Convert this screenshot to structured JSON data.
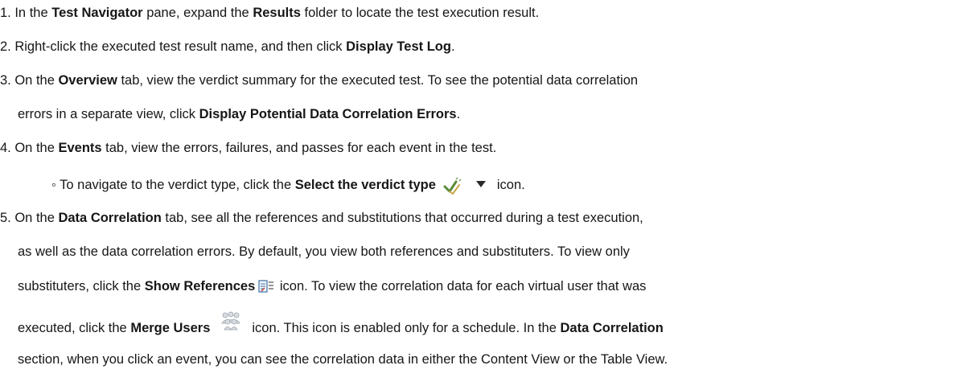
{
  "steps": [
    {
      "number": "1.",
      "t1": " In the ",
      "b1": "Test Navigator",
      "t2": " pane, expand the ",
      "b2": "Results",
      "t3": " folder to locate the test execution result."
    },
    {
      "number": "2.",
      "t1": " Right-click the executed test result name, and then click ",
      "b1": "Display Test Log",
      "t2": "."
    },
    {
      "number": "3.",
      "t1": " On the ",
      "b1": "Overview",
      "t2": " tab, view the verdict summary for the executed test. To see the potential data correlation",
      "t3": "errors in a separate view, click ",
      "b2": "Display Potential Data Correlation Errors",
      "t4": "."
    },
    {
      "number": "4.",
      "t1": " On the ",
      "b1": "Events",
      "t2": " tab, view the errors, failures, and passes for each event in the test.",
      "sub_bullet": "◦",
      "sub_t1": " To navigate to the verdict type, click the ",
      "sub_b1": "Select the verdict type",
      "sub_t2": "icon.",
      "sub_icon1": "verdict-checkmark-icon",
      "sub_icon2": "dropdown-arrow-icon"
    },
    {
      "number": "5.",
      "t1": " On the ",
      "b1": "Data Correlation",
      "t2": " tab, see all the references and substitutions that occurred during a test execution,",
      "t3": "as well as the data correlation errors. By default, you view both references and substituters. To view only",
      "t4": "substituters, click the ",
      "b2": "Show References",
      "t5": " icon. To view the correlation data for each virtual user that was",
      "t6": "executed, click the ",
      "b3": "Merge Users",
      "t7": "icon. This icon is enabled only for a schedule. In the ",
      "b4": "Data Correlation",
      "t8": "section, when you click an event, you can see the correlation data in either the Content View or the Table View.",
      "icon1": "show-references-icon",
      "icon2": "merge-users-icon"
    }
  ]
}
